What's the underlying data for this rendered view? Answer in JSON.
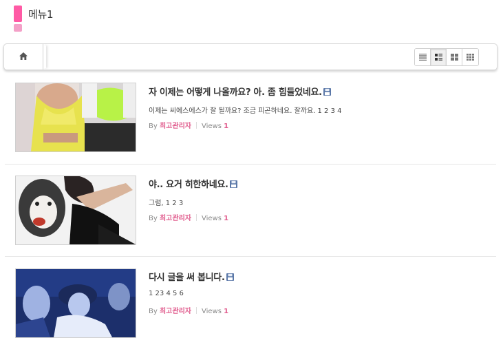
{
  "header": {
    "title": "메뉴1"
  },
  "toolbar": {
    "home_icon": "home-icon",
    "view_modes": [
      {
        "icon": "list-view-icon",
        "active": false
      },
      {
        "icon": "webzine-view-icon",
        "active": true
      },
      {
        "icon": "gallery-view-icon",
        "active": false
      },
      {
        "icon": "grid-view-icon",
        "active": false
      }
    ]
  },
  "posts": [
    {
      "title": "자 이제는 어떻게 나올까요? 아. 좀 힘들었네요.",
      "summary": "이제는 씨에스에스가 잘 될까요? 조금 피곤하네요. 잘까요. 1 2 3 4",
      "by": "By",
      "author": "최고관리자",
      "views_label": "Views",
      "views": "1"
    },
    {
      "title": "야.. 요거 히한하네요.",
      "summary": "그럼, 1 2 3",
      "by": "By",
      "author": "최고관리자",
      "views_label": "Views",
      "views": "1"
    },
    {
      "title": "다시 글을 써 봅니다.",
      "summary": "1 23 4 5 6",
      "by": "By",
      "author": "최고관리자",
      "views_label": "Views",
      "views": "1"
    }
  ]
}
